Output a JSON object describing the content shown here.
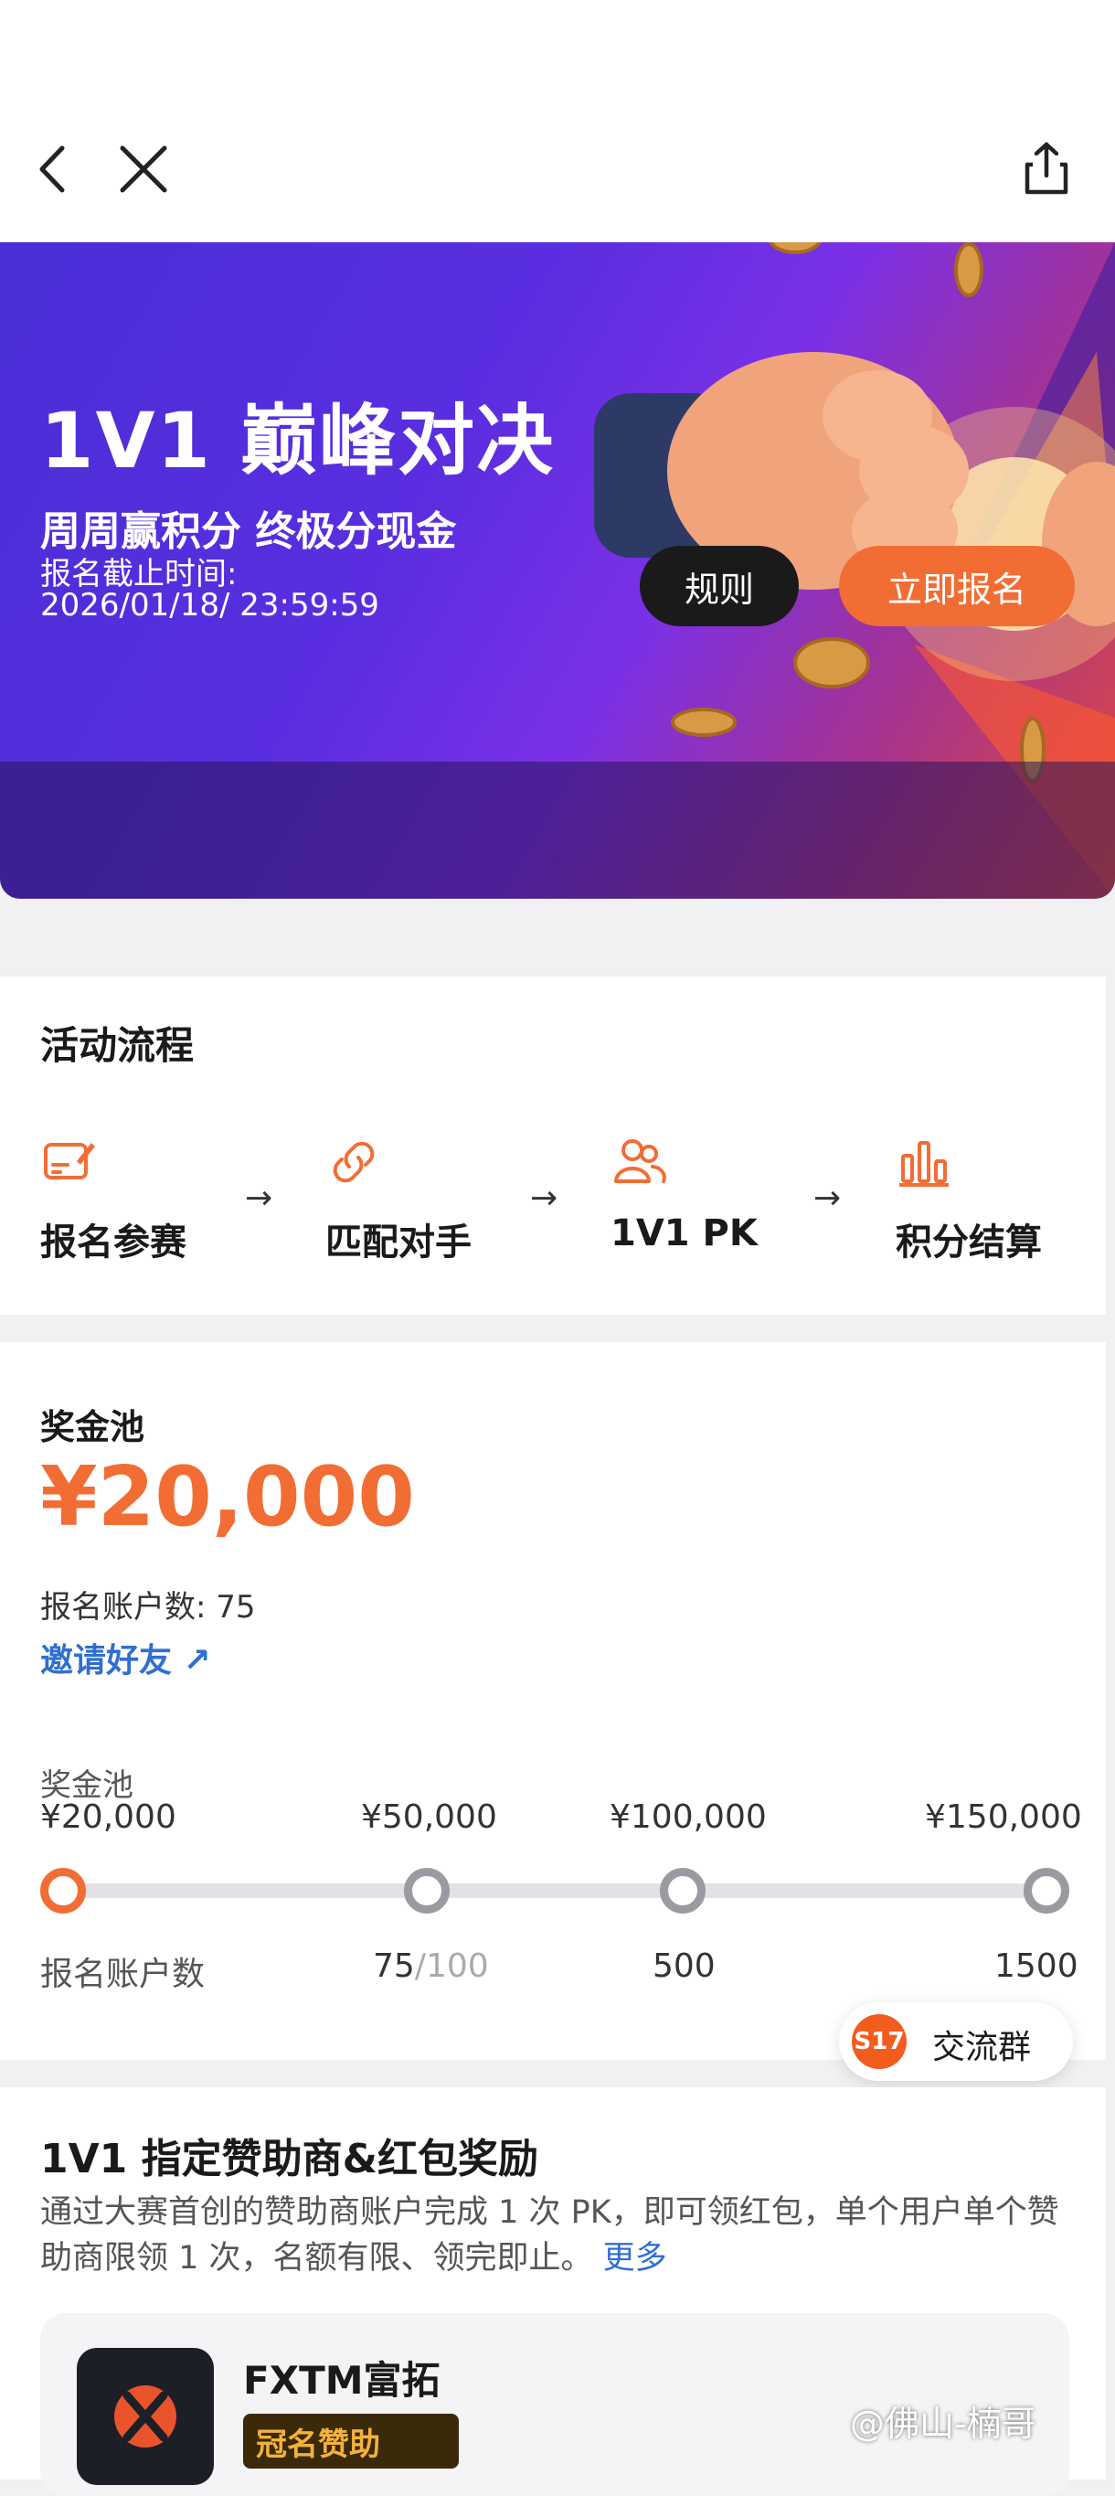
{
  "hero": {
    "title": "1V1 巅峰对决",
    "subtitle": "周周赢积分 终极分现金",
    "deadline_label": "报名截止时间:",
    "deadline_value": "2026/01/18/ 23:59:59",
    "rules_button": "规则",
    "signup_button": "立即报名"
  },
  "flow": {
    "title": "活动流程",
    "steps": [
      {
        "label": "报名参赛",
        "icon": "form-edit-icon"
      },
      {
        "label": "匹配对手",
        "icon": "link-icon"
      },
      {
        "label": "1V1 PK",
        "icon": "users-icon"
      },
      {
        "label": "积分结算",
        "icon": "bar-chart-icon"
      }
    ],
    "arrow": "→"
  },
  "prize": {
    "label": "奖金池",
    "amount": "¥20,000",
    "account_count_text": "报名账户数:   75",
    "invite_text": "邀请好友 ↗",
    "milestone_pool_label": "奖金池",
    "milestone_count_label": "报名账户数",
    "milestones": [
      {
        "amount": "¥20,000",
        "count": ""
      },
      {
        "amount": "¥50,000",
        "count_current": "75",
        "count_target": "/100"
      },
      {
        "amount": "¥100,000",
        "count": "500"
      },
      {
        "amount": "¥150,000",
        "count": "1500"
      }
    ],
    "progress_reached_index": 0
  },
  "float_group": {
    "badge": "S17",
    "label": "交流群"
  },
  "sponsor": {
    "title": "1V1 指定赞助商&红包奖励",
    "description": "通过大赛首创的赞助商账户完成 1 次 PK，即可领红包，单个用户单个赞助商限领 1 次，名额有限、领完即止。",
    "more": "更多",
    "name": "FXTM富拓",
    "badge": "冠名赞助"
  },
  "watermark": "@佛山-楠哥",
  "colors": {
    "accent": "#f26d34",
    "link": "#2f6fd0",
    "hero_start": "#4a2ed6",
    "hero_end": "#e04a3a"
  }
}
